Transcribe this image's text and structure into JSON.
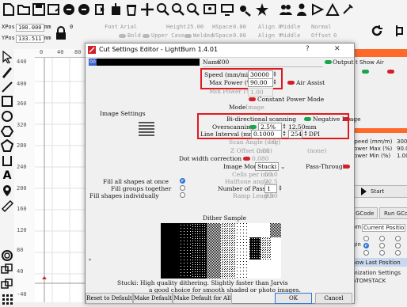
{
  "toolbar": {
    "icons": [
      "new-file-icon",
      "open-icon",
      "save-icon",
      "save-as-icon",
      "undo-icon",
      "redo-icon",
      "import-icon",
      "cut-icon",
      "delete-icon",
      "move-icon",
      "zoom-in-icon",
      "zoom-out-icon",
      "zoom-fit-icon",
      "frame-icon",
      "monitor-icon",
      "settings-icon",
      "users-icon",
      "trace-icon",
      "sparkle-icon"
    ]
  },
  "propbar": {
    "xpos_label": "XPos",
    "xpos_value": "100.000",
    "ypos_label": "YPos",
    "ypos_value": "133.511",
    "unit": "mm",
    "width_value": "0",
    "font_label": "Font",
    "font_value": "Arial",
    "height_label": "Height",
    "height_value": "25.00",
    "hspace_label": "HSpace",
    "hspace_value": "0.00",
    "align_x_label": "Align X",
    "align_x_value": "Middle",
    "normal_label": "Normal",
    "bold_label": "Bold",
    "upper_case_label": "Upper Case",
    "welded_label": "Welded",
    "vspace_label": "VSpace",
    "vspace_value": "0.00",
    "align_y_label": "Align Y",
    "align_y_value": "Middle",
    "offset_label": "Offset",
    "offset_value": "0"
  },
  "ruler": {
    "top": [
      "0",
      "40",
      "80"
    ],
    "left": [
      "440",
      "400",
      "360",
      "320",
      "280",
      "240",
      "200",
      "160",
      "120",
      "80",
      "40",
      "-40"
    ]
  },
  "right": {
    "show_air": "t Show Air",
    "speed": "Speed (mm/m)",
    "speed_val": "3000",
    "power_max": "Power Max (%)",
    "power_max_val": "90.00",
    "power_min": "Power Min (%)",
    "power_min_val": "1.00",
    "start": "Start",
    "gcode": "GCode",
    "run_gcode": "Run GCod",
    "from_label": "om:",
    "from_value": "Current Positio",
    "origin_label": "gin",
    "show_last": "how Last Position",
    "opt_settings": "mization Settings",
    "atomstack": "ATOMSTACK"
  },
  "dialog": {
    "title": "Cut Settings Editor - LightBurn 1.4.01",
    "help": "?",
    "close": "✕",
    "layer_number": "00",
    "name_label": "Name",
    "name_value": "C00",
    "output_label": "Output",
    "speed_label": "Speed (mm/min)",
    "speed_value": "30000",
    "max_power_label": "Max Power (%)",
    "max_power_value": "90.00",
    "air_assist_label": "Air Assist",
    "min_power_label": "Min Power (%)",
    "min_power_value": "1.00",
    "constant_power_label": "Constant Power Mode",
    "mode_label": "Mode",
    "mode_value": "Image",
    "image_settings": "Image Settings",
    "bidir_label": "Bi-directional scanning",
    "negative_label": "Negative Image",
    "overscan_label": "Overscanning",
    "overscan_value": "2.5%",
    "overscan_mm": "12.50mm",
    "interval_label": "Line Interval (mm)",
    "interval_value": "0.1000",
    "dpi_value": "254",
    "dpi_label": "DPI",
    "scan_angle_label": "Scan Angle (deg)",
    "scan_angle_value": "0",
    "z_offset_label": "Z Offset (mm)",
    "z_offset_value": "0.00",
    "none_label": "(none)",
    "dot_width_label": "Dot width correction",
    "dot_width_value": "0.080",
    "image_mode_label": "Image Mode",
    "image_mode_value": "Stucki",
    "pass_through_label": "Pass-Through",
    "cells_label": "Cells per inch",
    "cells_value": "50.0",
    "halftone_label": "Halftone angle",
    "halftone_value": "22.5",
    "passes_label": "Number of Passes",
    "passes_value": "1",
    "ramp_label": "Ramp Length",
    "ramp_value": "0.00",
    "fill_all": "Fill all shapes at once",
    "fill_groups": "Fill groups together",
    "fill_individually": "Fill shapes individually",
    "dither_sample": "Dither Sample",
    "description_line1": "Stucki: High quality dithering. Slightly faster than Jarvis",
    "description_line2": "a good choice for smooth shaded or photo images.",
    "reset_default": "Reset to Default",
    "make_default": "Make Default",
    "make_default_all": "Make Default for All",
    "ok": "OK",
    "cancel": "Cancel"
  },
  "colors": {
    "accent_red": "#e0191f",
    "toggle_green": "#19a64a",
    "toggle_red": "#d21f2a",
    "radio_blue": "#2a74d6"
  }
}
